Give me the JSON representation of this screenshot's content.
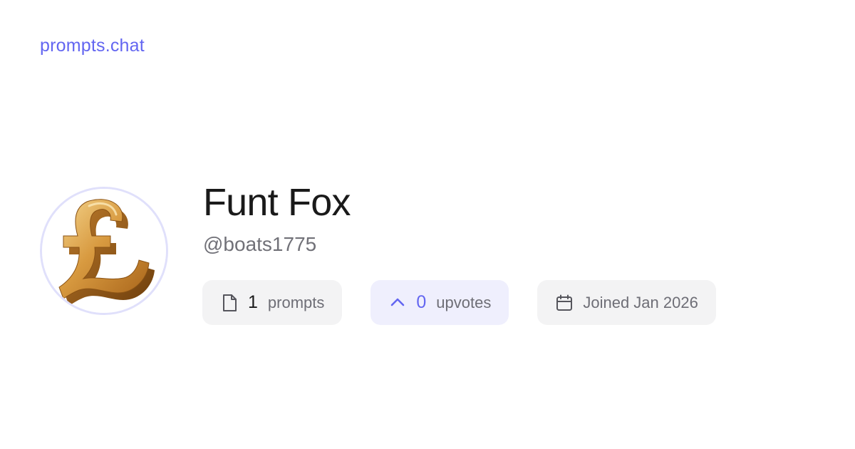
{
  "brand": {
    "name": "prompts.chat",
    "color": "#6366f1"
  },
  "profile": {
    "display_name": "Funt Fox",
    "username": "@boats1775",
    "avatar_icon": "pound-sterling-icon"
  },
  "stats": {
    "prompts": {
      "icon": "file-icon",
      "count": "1",
      "label": "prompts"
    },
    "upvotes": {
      "icon": "chevron-up-icon",
      "count": "0",
      "label": "upvotes"
    },
    "joined": {
      "icon": "calendar-icon",
      "label": "Joined Jan 2026"
    }
  }
}
